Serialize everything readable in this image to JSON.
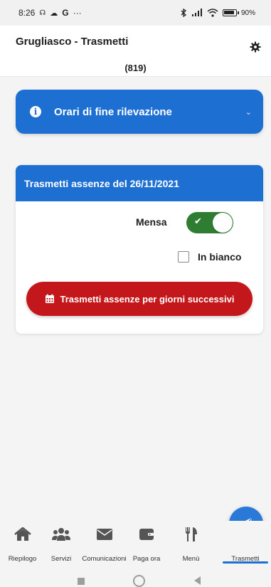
{
  "status_bar": {
    "time": "8:26",
    "left_icons": [
      "notification-icon",
      "cloud-icon",
      "google-icon",
      "more-icon"
    ],
    "right_icons": [
      "bluetooth-icon",
      "signal-icon",
      "wifi-icon",
      "battery-icon"
    ],
    "battery": "90%"
  },
  "header": {
    "title": "Grugliasco - Trasmetti",
    "subtitle": "(819)",
    "settings_icon": "gear-icon"
  },
  "info_bar": {
    "label": "Orari di fine rilevazione",
    "icon": "info-icon",
    "chevron": "chevron-down-icon"
  },
  "card": {
    "title": "Trasmetti assenze del 26/11/2021",
    "mensa_label": "Mensa",
    "mensa_on": true,
    "bianco_label": "In bianco",
    "bianco_checked": false,
    "button_label": "Trasmetti assenze per giorni successivi",
    "button_icon": "calendar-icon"
  },
  "fab": {
    "icon": "send-icon"
  },
  "bottom_nav": {
    "items": [
      {
        "label": "Riepilogo",
        "icon": "home-icon"
      },
      {
        "label": "Servizi",
        "icon": "users-icon"
      },
      {
        "label": "Comunicazioni",
        "icon": "envelope-icon"
      },
      {
        "label": "Paga ora",
        "icon": "wallet-icon"
      },
      {
        "label": "Menù",
        "icon": "utensils-icon"
      },
      {
        "label": "Trasmetti",
        "icon": "send-icon",
        "active": true
      }
    ]
  },
  "colors": {
    "primary": "#1e6fd2",
    "danger": "#c3171c",
    "toggle_on": "#2e7d32"
  }
}
